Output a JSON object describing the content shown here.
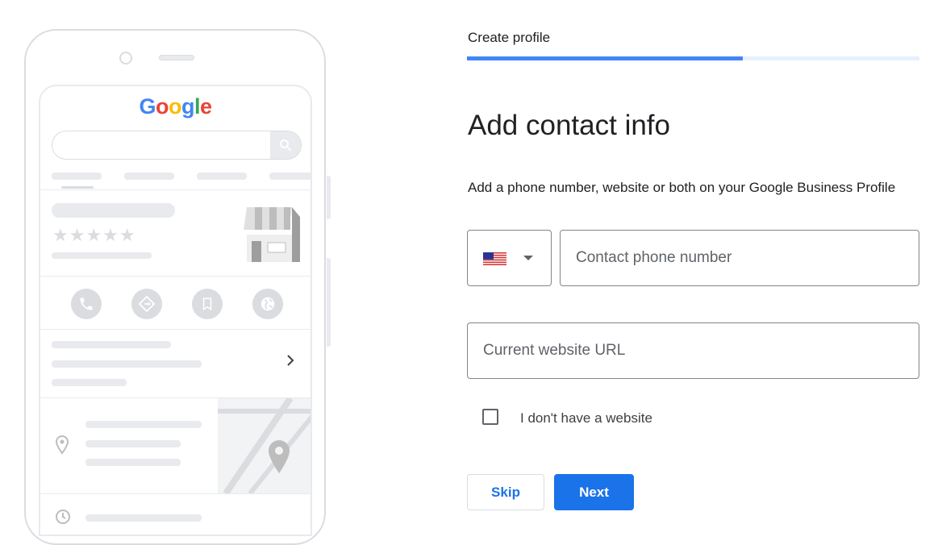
{
  "illustration": {
    "logo_letters": [
      {
        "ch": "G",
        "color": "#4285f4"
      },
      {
        "ch": "o",
        "color": "#ea4335"
      },
      {
        "ch": "o",
        "color": "#fbbc05"
      },
      {
        "ch": "g",
        "color": "#4285f4"
      },
      {
        "ch": "l",
        "color": "#34a853"
      },
      {
        "ch": "e",
        "color": "#ea4335"
      }
    ],
    "stars": "★★★★★",
    "action_icons": [
      "phone-icon",
      "directions-icon",
      "bookmark-icon",
      "globe-icon"
    ]
  },
  "stepper": {
    "step_label": "Create profile",
    "progress": 0.61
  },
  "form": {
    "title": "Add contact info",
    "description": "Add a phone number, website or both on your Google Business Profile",
    "country": "us-flag-icon",
    "phone_placeholder": "Contact phone number",
    "website_placeholder": "Current website URL",
    "no_website_label": "I don't have a website",
    "no_website_checked": false
  },
  "actions": {
    "skip_label": "Skip",
    "next_label": "Next"
  },
  "colors": {
    "accent": "#1a73e8",
    "progress": "#4285f4",
    "placeholder_gray": "#dadce0"
  }
}
